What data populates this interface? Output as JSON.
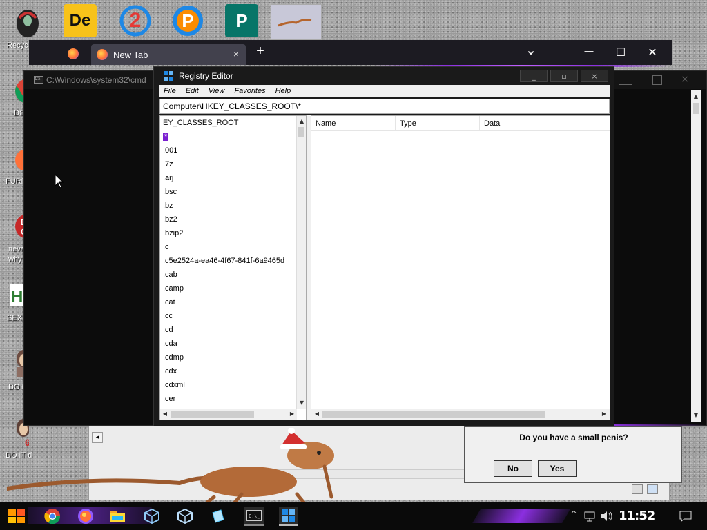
{
  "desktop": {
    "icons": [
      {
        "label": "Recyc"
      },
      {
        "label": "DC"
      },
      {
        "label": "FURF"
      },
      {
        "label": "neve"
      },
      {
        "label": "why"
      },
      {
        "label": "SEX"
      },
      {
        "label": "DO I"
      },
      {
        "label": "DO IT d"
      }
    ],
    "top_icons": [
      {
        "text": "De"
      },
      {
        "text": "2"
      },
      {
        "text": "P"
      },
      {
        "text": "P"
      }
    ]
  },
  "firefox": {
    "tab_label": "New Tab",
    "tab_close": "×",
    "new_tab": "+",
    "list_tabs": "⌄",
    "minimize": "—",
    "maximize": "☐",
    "close": "✕"
  },
  "cmd": {
    "title": "C:\\Windows\\system32\\cmd",
    "icon_text": "C:\\_"
  },
  "regedit": {
    "title": "Registry Editor",
    "controls": {
      "minimize": "_",
      "maximize": "▫",
      "close": "×"
    },
    "menu": [
      "File",
      "Edit",
      "View",
      "Favorites",
      "Help"
    ],
    "path": "Computer\\HKEY_CLASSES_ROOT\\*",
    "tree_root": "EY_CLASSES_ROOT",
    "tree_items": [
      "*",
      ".001",
      ".7z",
      ".arj",
      ".bsc",
      ".bz",
      ".bz2",
      ".bzip2",
      ".c",
      ".c5e2524a-ea46-4f67-841f-6a9465d",
      ".cab",
      ".camp",
      ".cat",
      ".cc",
      ".cd",
      ".cda",
      ".cdmp",
      ".cdx",
      ".cdxml",
      ".cer"
    ],
    "selected_index": 0,
    "columns": [
      "Name",
      "Type",
      "Data"
    ],
    "accent_color": "#7a1fd0"
  },
  "dialog": {
    "question": "Do you have a small penis?",
    "no_label": "No",
    "yes_label": "Yes"
  },
  "taskbar": {
    "clock": "11:52 AM",
    "app_icons": [
      "start-icon",
      "chrome-icon",
      "firefox-icon",
      "file-explorer-icon",
      "virtualbox-icon",
      "virtualbox-icon-2",
      "glass-app-icon",
      "cmd-icon",
      "regedit-icon"
    ]
  }
}
